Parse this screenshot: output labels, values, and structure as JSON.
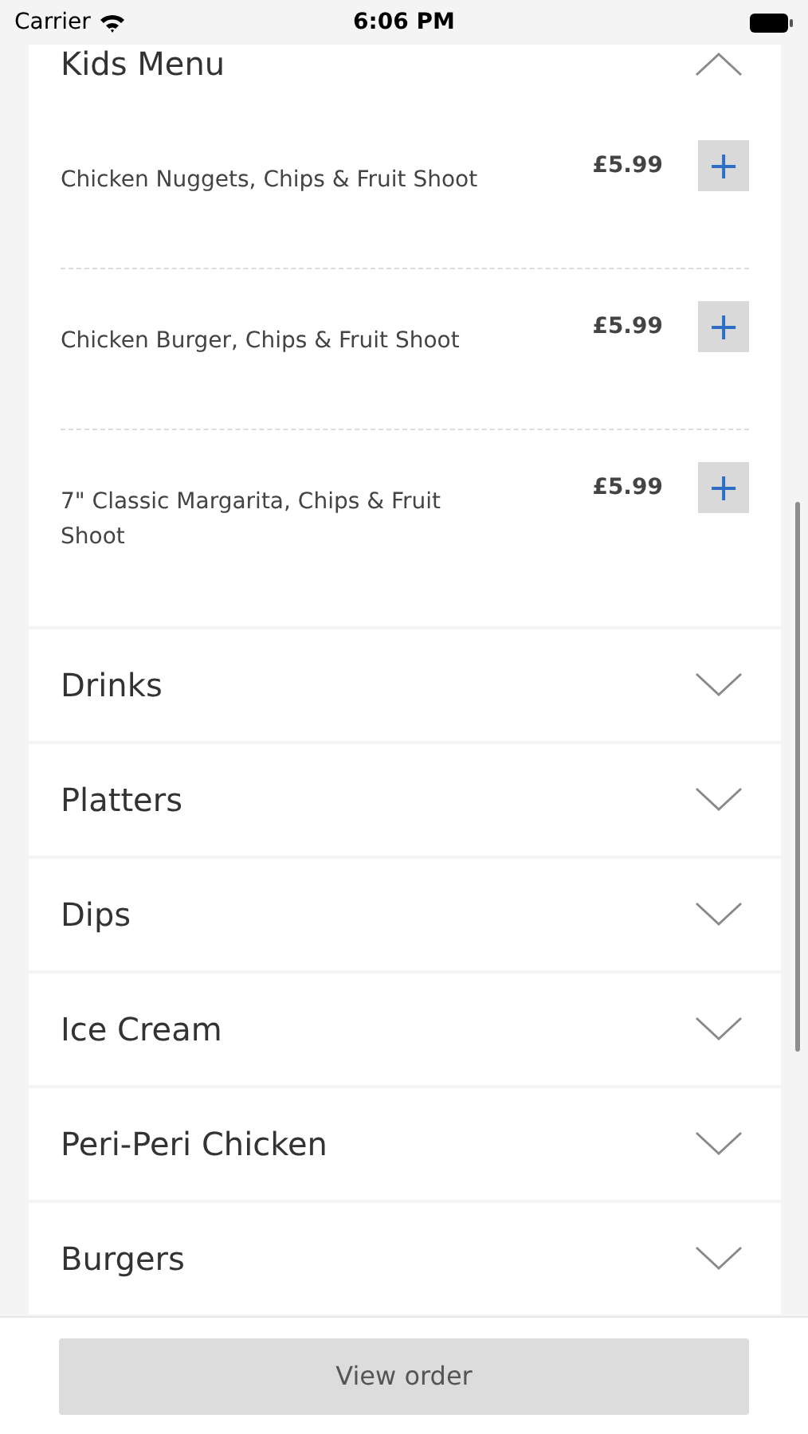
{
  "status_bar": {
    "carrier": "Carrier",
    "time": "6:06 PM"
  },
  "categories": [
    {
      "name": "Kids Menu",
      "expanded": true,
      "items": [
        {
          "name": "Chicken Nuggets, Chips & Fruit Shoot",
          "price": "£5.99",
          "add": "+"
        },
        {
          "name": "Chicken Burger, Chips & Fruit Shoot",
          "price": "£5.99",
          "add": "+"
        },
        {
          "name": "7\" Classic Margarita, Chips & Fruit Shoot",
          "price": "£5.99",
          "add": "+"
        }
      ]
    },
    {
      "name": "Drinks",
      "expanded": false
    },
    {
      "name": "Platters",
      "expanded": false
    },
    {
      "name": "Dips",
      "expanded": false
    },
    {
      "name": "Ice Cream",
      "expanded": false
    },
    {
      "name": "Peri-Peri Chicken",
      "expanded": false
    },
    {
      "name": "Burgers",
      "expanded": false
    }
  ],
  "footer": {
    "button": "View order"
  }
}
